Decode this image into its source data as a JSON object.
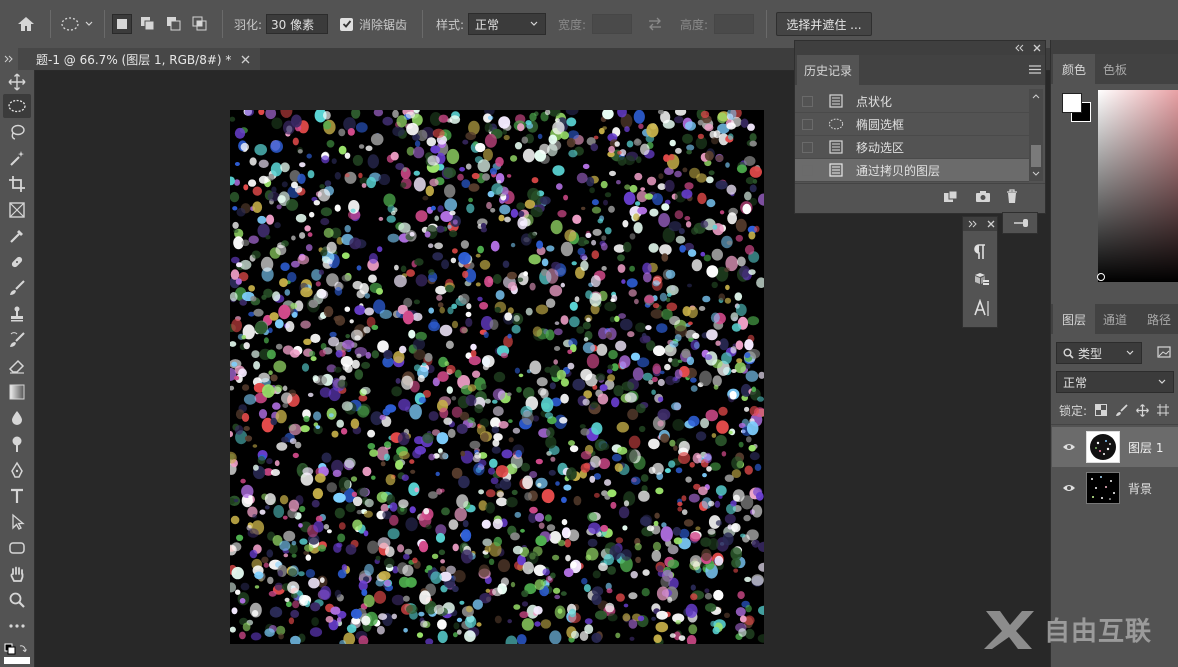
{
  "options_bar": {
    "feather_label": "羽化:",
    "feather_value": "30 像素",
    "antialias_label": "消除锯齿",
    "style_label": "样式:",
    "style_value": "正常",
    "width_label": "宽度:",
    "height_label": "高度:",
    "select_mask_button": "选择并遮住 ..."
  },
  "document_tab": {
    "title": "题-1 @ 66.7% (图层 1, RGB/8#) *"
  },
  "history_panel": {
    "tab_label": "历史记录",
    "items": [
      {
        "label": "点状化",
        "icon": "document-icon"
      },
      {
        "label": "椭圆选框",
        "icon": "ellipse-marquee-icon"
      },
      {
        "label": "移动选区",
        "icon": "document-icon"
      },
      {
        "label": "通过拷贝的图层",
        "icon": "document-icon"
      }
    ],
    "selected_index": 3
  },
  "color_panel": {
    "tabs": [
      "颜色",
      "色板"
    ],
    "foreground": "#ffffff",
    "background": "#000000",
    "hue_color": "#e8a0a4"
  },
  "layers_panel": {
    "tabs": [
      "图层",
      "通道",
      "路径"
    ],
    "filter_kind": "类型",
    "blend_mode": "正常",
    "lock_label": "锁定:",
    "layers": [
      {
        "name": "图层 1",
        "visible": true,
        "selected": true
      },
      {
        "name": "背景",
        "visible": true,
        "selected": false
      }
    ]
  },
  "watermark": {
    "text": "自由互联"
  },
  "colors": {
    "panel_bg": "#535353",
    "workspace_bg": "#282828",
    "selection_row": "#6b6b6b"
  }
}
